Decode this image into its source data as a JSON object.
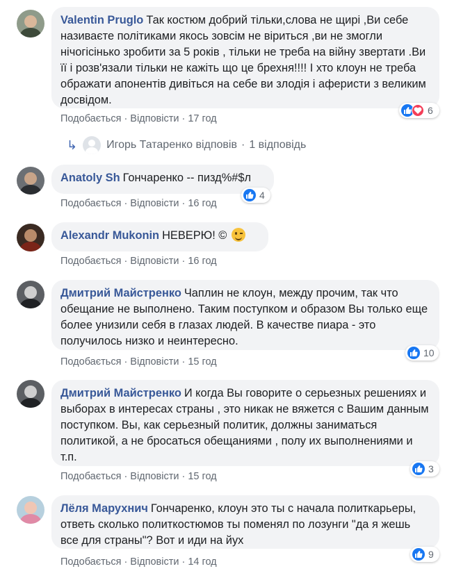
{
  "comments": [
    {
      "author": "Valentin Pruglo",
      "text": "Так костюм добрий тільки,слова не щирі ,Ви себе називаєте політиками якось зовсім не віриться ,ви не змогли нічогісінько зробити за 5 років , тільки не треба на війну звертати .Ви її і розв'язали тільки не кажіть що це брехня!!!! І хто клоун не треба ображати апонентів дивіться на себе ви злодія і аферисти з великим досвідом.",
      "like_label": "Подобається",
      "reply_label": "Відповісти",
      "time": "17 год",
      "reactions": {
        "count": "6",
        "icons": [
          "like-icon",
          "love-icon"
        ]
      }
    },
    {
      "author": "Anatoly Sh",
      "text": "Гончаренко -- пизд%#$л",
      "like_label": "Подобається",
      "reply_label": "Відповісти",
      "time": "16 год",
      "reactions": {
        "count": "4",
        "icons": [
          "like-icon"
        ]
      }
    },
    {
      "author": "Alexandr Mukonin",
      "text": "НЕВЕРЮ! ©",
      "emoji": "winking-face-emoji",
      "like_label": "Подобається",
      "reply_label": "Відповісти",
      "time": "16 год"
    },
    {
      "author": "Дмитрий Майстренко",
      "text": "Чаплин не клоун, между прочим, так что обещание не выполнено. Таким поступком и образом Вы только еще более унизили себя в глазах людей. В качестве пиара - это получилось низко и неинтересно.",
      "like_label": "Подобається",
      "reply_label": "Відповісти",
      "time": "15 год",
      "reactions": {
        "count": "10",
        "icons": [
          "like-icon"
        ]
      }
    },
    {
      "author": "Дмитрий Майстренко",
      "text": "И когда Вы говорите о серьезных решениях и выборах в интересах страны , это никак не вяжется с Вашим данным поступком. Вы, как серьезный политик, должны заниматься политикой, а не бросаться обещаниями , полу их выполнениями и т.п.",
      "like_label": "Подобається",
      "reply_label": "Відповісти",
      "time": "15 год",
      "reactions": {
        "count": "3",
        "icons": [
          "like-icon"
        ]
      }
    },
    {
      "author": "Лёля Марухнич",
      "text": "Гончаренко, клоун это ты с начала политкарьеры, ответь сколько политкостюмов ты поменял по лозунги \"да я жешь все для страны\"? Вот и иди на йух",
      "like_label": "Подобається",
      "reply_label": "Відповісти",
      "time": "14 год",
      "reactions": {
        "count": "9",
        "icons": [
          "like-icon"
        ]
      }
    }
  ],
  "reply_thread": {
    "author": "Игорь Татаренко",
    "action": "відповів",
    "separator": "·",
    "count_text": "1 відповідь"
  },
  "colors": {
    "author": "#385898",
    "bubble": "#f2f3f5",
    "meta": "#606770",
    "like": "#1877f2",
    "love": "#f33e58"
  }
}
